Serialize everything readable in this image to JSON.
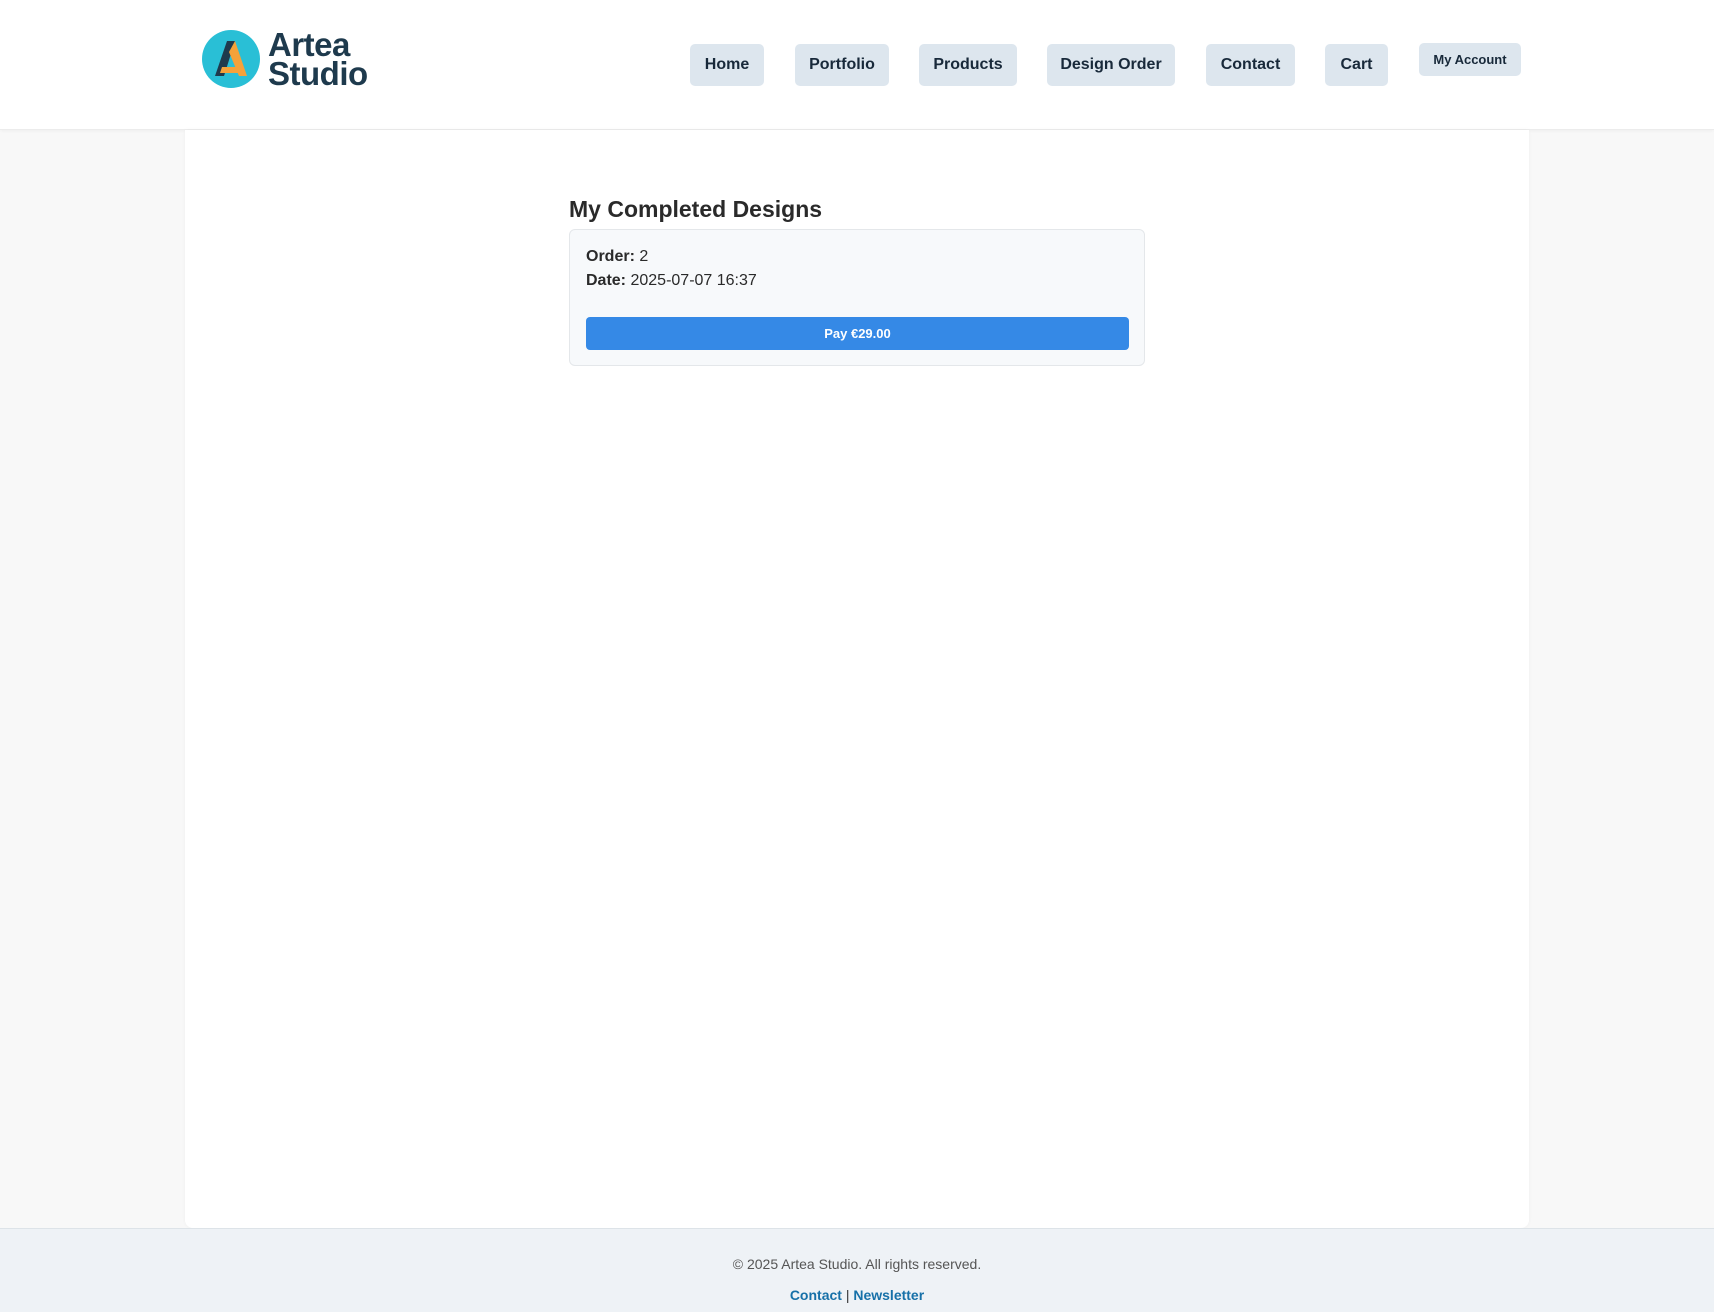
{
  "brand": {
    "name_line1": "Artea",
    "name_line2": "Studio",
    "logo_icon": "letter-a-logo-icon",
    "colors": {
      "circle": "#29bfd6",
      "a_dark": "#1e3a4d",
      "a_accent": "#f4a23a",
      "text": "#1e3a4d"
    }
  },
  "nav": {
    "home": "Home",
    "portfolio": "Portfolio",
    "products": "Products",
    "design_order": "Design Order",
    "contact": "Contact",
    "cart": "Cart",
    "my_account": "My Account"
  },
  "main": {
    "title": "My Completed Designs",
    "order": {
      "order_label": "Order:",
      "order_value": "2",
      "date_label": "Date:",
      "date_value": "2025-07-07 16:37",
      "pay_label": "Pay €29.00"
    }
  },
  "footer": {
    "copyright": "© 2025 Artea Studio. All rights reserved.",
    "contact": "Contact",
    "separator": "|",
    "newsletter": "Newsletter"
  },
  "colors": {
    "nav_button_bg": "#dde6ee",
    "pay_button_bg": "#3589e6",
    "footer_link": "#1670a8"
  }
}
